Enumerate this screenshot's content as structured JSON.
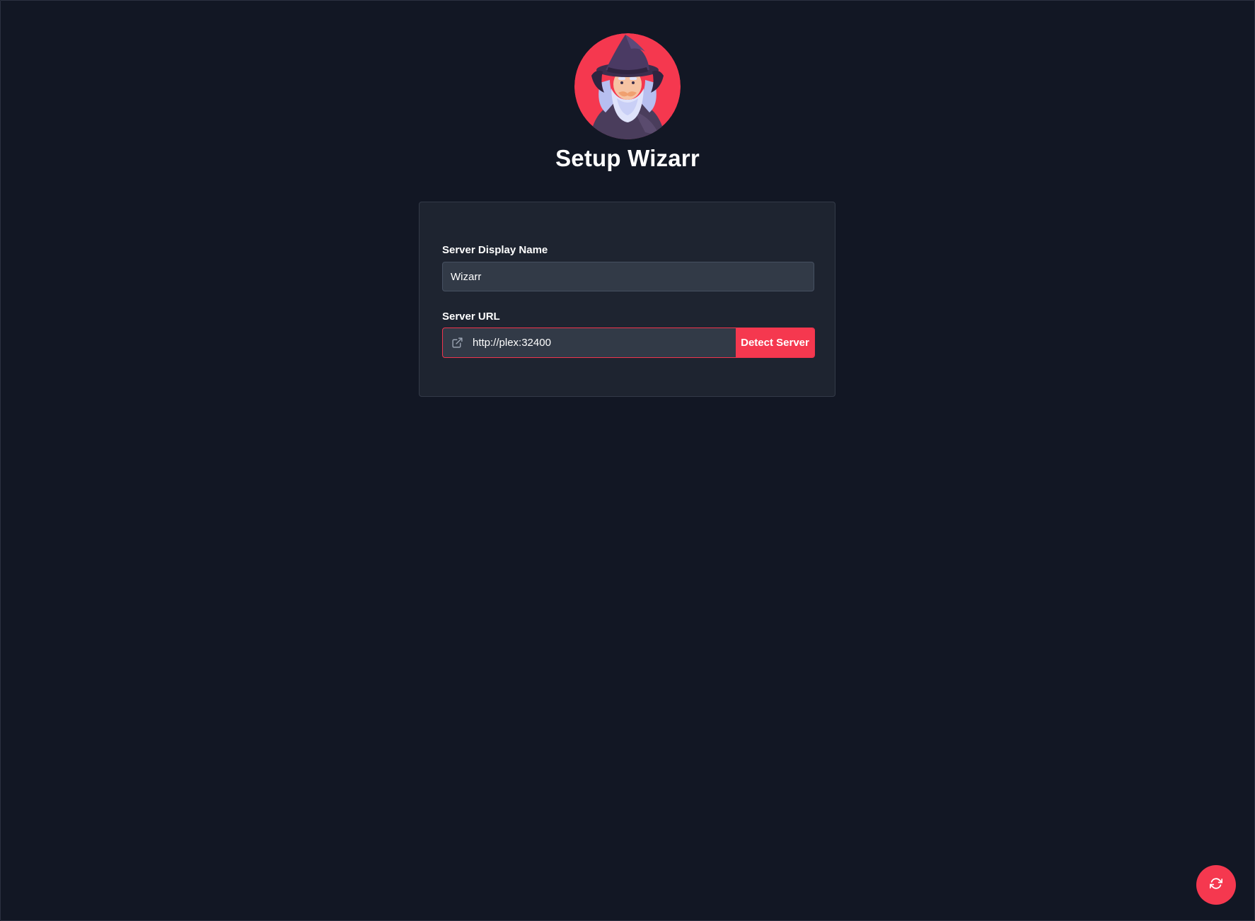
{
  "app": {
    "title": "Setup Wizarr",
    "logo_icon": "wizard-avatar-icon"
  },
  "form": {
    "server_name": {
      "label": "Server Display Name",
      "value": "Wizarr"
    },
    "server_url": {
      "label": "Server URL",
      "value": "http://plex:32400",
      "icon": "external-link-icon"
    },
    "detect_button_label": "Detect Server"
  },
  "fab": {
    "icon": "refresh-icon"
  },
  "colors": {
    "background": "#121724",
    "card": "#1e2430",
    "input": "#323a47",
    "accent": "#f5384f"
  }
}
